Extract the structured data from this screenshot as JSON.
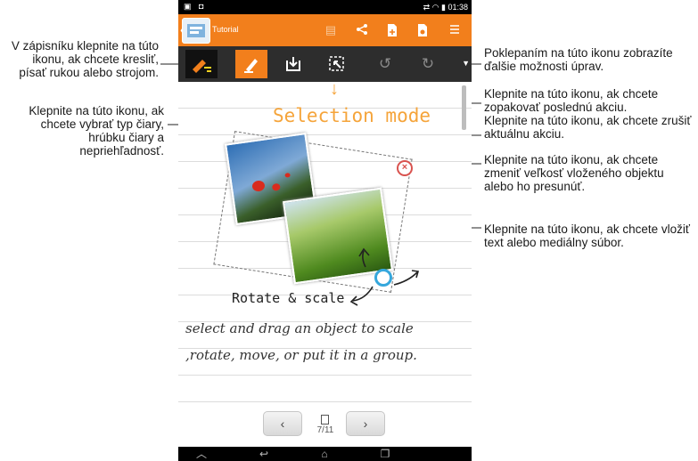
{
  "callouts": {
    "draw_mode": "V zápisníku klepnite na túto ikonu, ak chcete kresliť, písať rukou alebo strojom.",
    "stroke": "Klepnite na túto ikonu, ak chcete vybrať typ čiary, hrúbku čiary a nepriehľadnosť.",
    "more_options": "Poklepaním na túto ikonu zobrazíte ďalšie možnosti úprav.",
    "redo": "Klepnite na túto ikonu, ak chcete zopakovať poslednú akciu.",
    "undo": "Klepnite na túto ikonu, ak chcete zrušiť aktuálnu akciu.",
    "resize": "Klepnite na túto ikonu, ak chcete zmeniť veľkosť vloženého objektu alebo ho presunúť.",
    "insert": "Klepnite na túto ikonu, ak chcete vložiť text alebo mediálny súbor."
  },
  "status_bar": {
    "left_icons": "▣ ◘",
    "right_text": "⇄ ◠ ▮ 01:38"
  },
  "app_bar": {
    "title": "Tutorial",
    "icons": [
      "save-icon",
      "share-icon",
      "add-page-icon",
      "page-settings-icon",
      "menu-icon"
    ]
  },
  "toolbar": {
    "icons": [
      "draw-mode-icon",
      "pen-icon",
      "insert-icon",
      "selection-icon",
      "undo-icon",
      "redo-icon",
      "more-options-icon"
    ],
    "active": "pen-icon"
  },
  "canvas": {
    "selection_mode": "Selection mode",
    "rotate_scale": "Rotate & scale",
    "hand_line1": "select and drag an object to scale",
    "hand_line2": ",rotate, move, or put it in a group."
  },
  "pager": {
    "prev": "‹",
    "next": "›",
    "page": "7/11"
  },
  "colors": {
    "accent": "#f27f1c",
    "toolbar": "#2d2d2d",
    "selection_text": "#f5a43a",
    "handle": "#35a7dc"
  }
}
